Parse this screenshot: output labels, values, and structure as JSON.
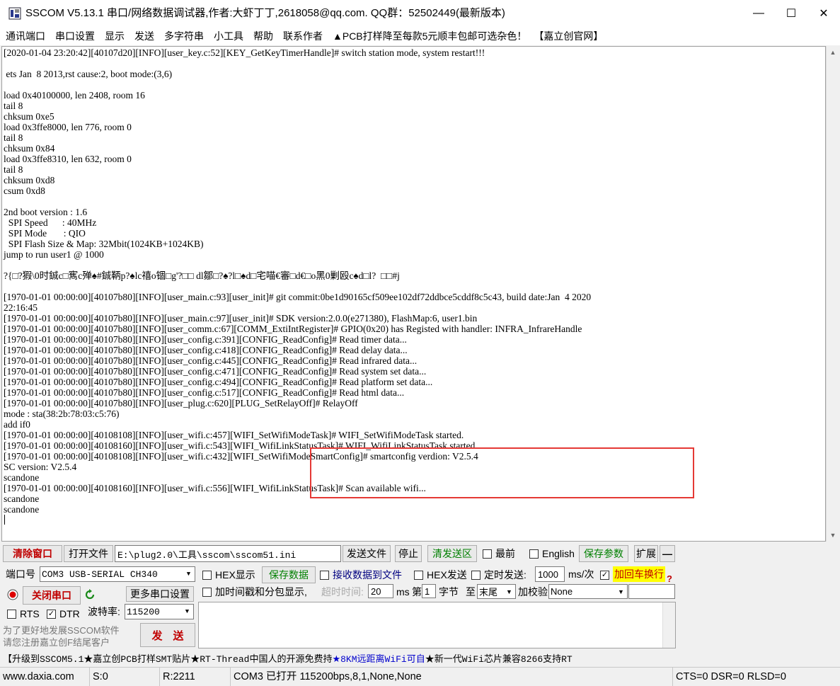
{
  "window": {
    "title": "SSCOM V5.13.1 串口/网络数据调试器,作者:大虾丁丁,2618058@qq.com. QQ群：52502449(最新版本)",
    "min_glyph": "—",
    "max_glyph": "☐",
    "close_glyph": "✕"
  },
  "menu": {
    "items": [
      "通讯端口",
      "串口设置",
      "显示",
      "发送",
      "多字符串",
      "小工具",
      "帮助",
      "联系作者"
    ],
    "ad1": "▲PCB打样降至每款5元顺丰包邮可选杂色！",
    "ad2": "【嘉立创官网】"
  },
  "log": {
    "lines": [
      "[2020-01-04 23:20:42][40107d20][INFO][user_key.c:52][KEY_GetKeyTimerHandle]# switch station mode, system restart!!!",
      "",
      " ets Jan  8 2013,rst cause:2, boot mode:(3,6)",
      "",
      "load 0x40100000, len 2408, room 16",
      "tail 8",
      "chksum 0xe5",
      "load 0x3ffe8000, len 776, room 0",
      "tail 8",
      "chksum 0x84",
      "load 0x3ffe8310, len 632, room 0",
      "tail 8",
      "chksum 0xd8",
      "csum 0xd8",
      "",
      "2nd boot version : 1.6",
      "  SPI Speed      : 40MHz",
      "  SPI Mode       : QIO",
      "  SPI Flash Size & Map: 32Mbit(1024KB+1024KB)",
      "jump to run user1 @ 1000",
      "",
      "?{□?猳\\0时鋮c□寯c殚♠#鋮鞆p?♠lc禧o锢□g'?□□ dl鄒□?♠?l□♠d□宅喵€審□d€□o黑0剿殴c♠d□l?  □□#j",
      "",
      "[1970-01-01 00:00:00][40107b80][INFO][user_main.c:93][user_init]# git commit:0be1d90165cf509ee102df72ddbce5cddf8c5c43, build date:Jan  4 2020",
      "22:16:45",
      "[1970-01-01 00:00:00][40107b80][INFO][user_main.c:97][user_init]# SDK version:2.0.0(e271380), FlashMap:6, user1.bin",
      "[1970-01-01 00:00:00][40107b80][INFO][user_comm.c:67][COMM_ExtiIntRegister]# GPIO(0x20) has Registed with handler: INFRA_InfrareHandle",
      "[1970-01-01 00:00:00][40107b80][INFO][user_config.c:391][CONFIG_ReadConfig]# Read timer data...",
      "[1970-01-01 00:00:00][40107b80][INFO][user_config.c:418][CONFIG_ReadConfig]# Read delay data...",
      "[1970-01-01 00:00:00][40107b80][INFO][user_config.c:445][CONFIG_ReadConfig]# Read infrared data...",
      "[1970-01-01 00:00:00][40107b80][INFO][user_config.c:471][CONFIG_ReadConfig]# Read system set data...",
      "[1970-01-01 00:00:00][40107b80][INFO][user_config.c:494][CONFIG_ReadConfig]# Read platform set data...",
      "[1970-01-01 00:00:00][40107b80][INFO][user_config.c:517][CONFIG_ReadConfig]# Read html data...",
      "[1970-01-01 00:00:00][40107b80][INFO][user_plug.c:620][PLUG_SetRelayOff]# RelayOff",
      "mode : sta(38:2b:78:03:c5:76)",
      "add if0",
      "[1970-01-01 00:00:00][40108108][INFO][user_wifi.c:457][WIFI_SetWifiModeTask]# WIFI_SetWifiModeTask started.",
      "[1970-01-01 00:00:00][40108160][INFO][user_wifi.c:543][WIFI_WifiLinkStatusTask]# WIFI_WifiLinkStatusTask started.",
      "[1970-01-01 00:00:00][40108108][INFO][user_wifi.c:432][WIFI_SetWifiModeSmartConfig]# smartconfig verdion: V2.5.4",
      "SC version: V2.5.4",
      "scandone",
      "[1970-01-01 00:00:00][40108160][INFO][user_wifi.c:556][WIFI_WifiLinkStatusTask]# Scan available wifi...",
      "scandone",
      "scandone"
    ]
  },
  "toolbar": {
    "clear_window": "清除窗口",
    "open_file": "打开文件",
    "file_path": "E:\\plug2.0\\工具\\sscom\\sscom51.ini",
    "send_file": "发送文件",
    "stop": "停止",
    "clear_send": "清发送区",
    "topmost": "最前",
    "english": "English",
    "save_params": "保存参数",
    "expand": "扩展",
    "collapse": "—"
  },
  "port": {
    "port_label": "端口号",
    "port_value": "COM3 USB-SERIAL CH340",
    "close_port": "关闭串口",
    "more_settings": "更多串口设置",
    "rts": "RTS",
    "dtr": "DTR",
    "baud_label": "波特率:",
    "baud_value": "115200",
    "promo1": "为了更好地发展SSCOM软件",
    "promo2": "请您注册嘉立创F结尾客户",
    "send": "发　送"
  },
  "options": {
    "hex_display": "HEX显示",
    "save_data": "保存数据",
    "recv_to_file": "接收数据到文件",
    "hex_send": "HEX发送",
    "timed_send": "定时发送:",
    "interval": "1000",
    "interval_unit": "ms/次",
    "add_crlf": "加回车换行",
    "timestamp": "加时间戳和分包显示,",
    "timeout_label": "超时时间:",
    "timeout": "20",
    "ms": "ms",
    "nth_label": "第",
    "nth": "1",
    "byte_label": "字节",
    "to_label": "至",
    "to_value": "末尾",
    "checksum_label": "加校验",
    "checksum_value": "None",
    "help": "?"
  },
  "ticker": {
    "part1": "【升级到SSCOM5.1",
    "part2": "★嘉立创PCB打样SMT贴片★RT-Thread中国人的开源免费持",
    "part3": "★8KM远距离WiFi可自",
    "part4": "★新一代WiFi芯片兼容8266支持RT"
  },
  "status": {
    "site": "www.daxia.com",
    "sent": "S:0",
    "received": "R:2211",
    "port_state": "COM3 已打开  115200bps,8,1,None,None",
    "lines": "CTS=0 DSR=0 RLSD=0"
  },
  "colors": {
    "highlight_border": "#e53935",
    "clear_button_text": "#c00000",
    "green_text": "#008000",
    "add_crlf_bg": "#ffff00"
  }
}
